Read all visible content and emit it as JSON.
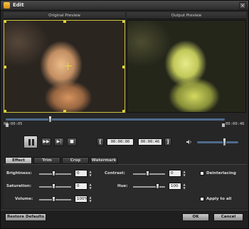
{
  "window": {
    "title": "Edit",
    "close_label": "×"
  },
  "preview": {
    "original_label": "Original Preview",
    "output_label": "Output Preview"
  },
  "timeline": {
    "start_time": "00:00:05",
    "end_time": "00:00:46"
  },
  "controls": {
    "start_time_value": "00:00:00",
    "end_time_value": "00:00:46",
    "volume_level": 0.65
  },
  "tabs": [
    {
      "label": "Effect",
      "active": true
    },
    {
      "label": "Trim",
      "active": false
    },
    {
      "label": "Crop",
      "active": false
    },
    {
      "label": "Watermark",
      "active": false
    }
  ],
  "effect": {
    "brightness_label": "Brightness:",
    "brightness_value": "0",
    "contrast_label": "Contrast:",
    "contrast_value": "0",
    "saturation_label": "Saturation:",
    "saturation_value": "0",
    "hue_label": "Hue:",
    "hue_value": "100",
    "volume_label": "Volume:",
    "volume_value": "100%",
    "deinterlacing_label": "Deinterlacing",
    "apply_all_label": "Apply to all"
  },
  "footer": {
    "restore_label": "Restore Defaults",
    "ok_label": "OK",
    "cancel_label": "Cancel"
  },
  "colors": {
    "accent_yellow": "#c9c23a",
    "track_blue": "#4e6a8a"
  }
}
